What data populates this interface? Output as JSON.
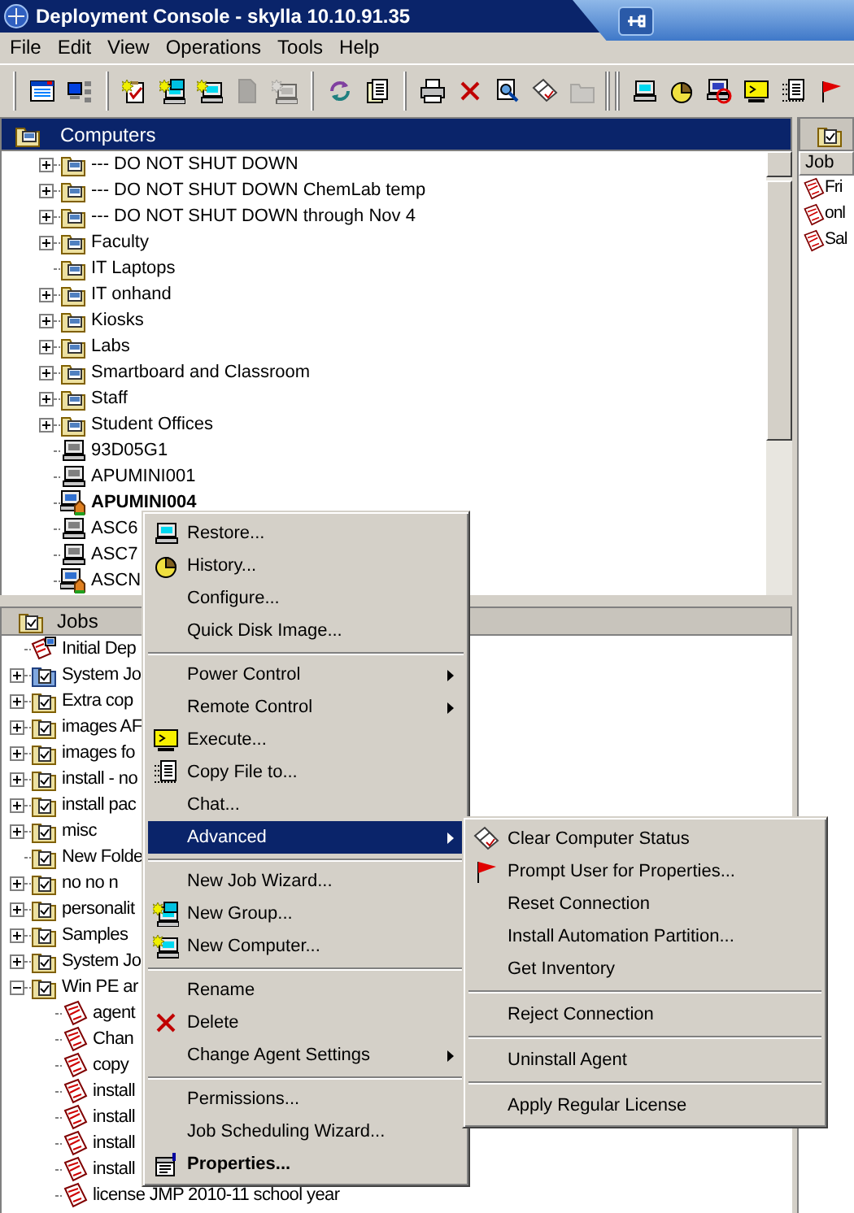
{
  "window": {
    "title": "Deployment Console - skylla 10.10.91.35"
  },
  "menu_bar": [
    "File",
    "Edit",
    "View",
    "Operations",
    "Tools",
    "Help"
  ],
  "toolbar": [
    [
      {
        "kind": "window",
        "disabled": false
      },
      {
        "kind": "network",
        "disabled": false
      }
    ],
    [
      {
        "kind": "clipboard-check",
        "disabled": false
      },
      {
        "kind": "computers-new",
        "disabled": false
      },
      {
        "kind": "computer-new",
        "disabled": false
      },
      {
        "kind": "document",
        "disabled": true
      },
      {
        "kind": "sparkle",
        "disabled": true
      }
    ],
    [
      {
        "kind": "refresh",
        "disabled": false
      },
      {
        "kind": "documents",
        "disabled": false
      }
    ],
    [
      {
        "kind": "printer",
        "disabled": false
      },
      {
        "kind": "delete",
        "disabled": false
      },
      {
        "kind": "magnifier",
        "disabled": false
      },
      {
        "kind": "papers",
        "disabled": false
      },
      {
        "kind": "folder",
        "disabled": true
      }
    ],
    [
      {
        "kind": "computer",
        "disabled": false
      },
      {
        "kind": "pie",
        "disabled": false
      },
      {
        "kind": "computer-red",
        "disabled": false
      },
      {
        "kind": "console",
        "disabled": false
      },
      {
        "kind": "doc-list",
        "disabled": false
      },
      {
        "kind": "flag",
        "disabled": false
      }
    ]
  ],
  "computers_pane": {
    "title": "Computers",
    "tree": [
      {
        "label": "--- DO NOT SHUT DOWN",
        "kind": "group",
        "has_children": true,
        "bold": false
      },
      {
        "label": "--- DO NOT SHUT DOWN ChemLab temp",
        "kind": "group",
        "has_children": true,
        "bold": false
      },
      {
        "label": "--- DO NOT SHUT DOWN through Nov 4",
        "kind": "group",
        "has_children": true,
        "bold": false
      },
      {
        "label": "Faculty",
        "kind": "group",
        "has_children": true,
        "bold": false
      },
      {
        "label": "IT Laptops",
        "kind": "group",
        "has_children": false,
        "bold": false
      },
      {
        "label": "IT onhand",
        "kind": "group",
        "has_children": true,
        "bold": false
      },
      {
        "label": "Kiosks",
        "kind": "group",
        "has_children": true,
        "bold": false
      },
      {
        "label": "Labs",
        "kind": "group",
        "has_children": true,
        "bold": false
      },
      {
        "label": "Smartboard and Classroom",
        "kind": "group",
        "has_children": true,
        "bold": false
      },
      {
        "label": "Staff",
        "kind": "group",
        "has_children": true,
        "bold": false
      },
      {
        "label": "Student Offices",
        "kind": "group",
        "has_children": true,
        "bold": false
      },
      {
        "label": "93D05G1",
        "kind": "computer-offline",
        "bold": false
      },
      {
        "label": "APUMINI001",
        "kind": "computer-offline",
        "bold": false
      },
      {
        "label": "APUMINI004",
        "kind": "computer-agent",
        "bold": true
      },
      {
        "label": "ASC6",
        "kind": "computer-offline",
        "bold": false
      },
      {
        "label": "ASC7",
        "kind": "computer-offline",
        "bold": false
      },
      {
        "label": "ASCN",
        "kind": "computer-agent",
        "bold": false
      }
    ]
  },
  "jobs_pane": {
    "title": "Jobs",
    "tree": [
      {
        "label": "Initial Dep",
        "kind": "job-special",
        "has_children": false
      },
      {
        "label": "System Jo",
        "kind": "system-folder",
        "has_children": true,
        "expanded": false
      },
      {
        "label": "Extra cop",
        "kind": "job-folder",
        "has_children": true,
        "expanded": false
      },
      {
        "label": "images AF",
        "kind": "job-folder",
        "has_children": true,
        "expanded": false
      },
      {
        "label": "images fo",
        "kind": "job-folder",
        "has_children": true,
        "expanded": false
      },
      {
        "label": "install - no",
        "kind": "job-folder",
        "has_children": true,
        "expanded": false
      },
      {
        "label": "install pac",
        "kind": "job-folder",
        "has_children": true,
        "expanded": false
      },
      {
        "label": "misc",
        "kind": "job-folder",
        "has_children": true,
        "expanded": false
      },
      {
        "label": "New Folde",
        "kind": "job-folder",
        "has_children": false
      },
      {
        "label": "no  no  n",
        "kind": "job-folder",
        "has_children": true,
        "expanded": false
      },
      {
        "label": "personalit",
        "kind": "job-folder",
        "has_children": true,
        "expanded": false
      },
      {
        "label": "Samples",
        "kind": "job-folder",
        "has_children": true,
        "expanded": false
      },
      {
        "label": "System Jo",
        "kind": "job-folder",
        "has_children": true,
        "expanded": false
      },
      {
        "label": "Win PE ar",
        "kind": "job-folder",
        "has_children": true,
        "expanded": true,
        "children": [
          {
            "label": "agent",
            "kind": "job"
          },
          {
            "label": "Chan",
            "kind": "job"
          },
          {
            "label": "copy",
            "kind": "job"
          },
          {
            "label": "install",
            "kind": "job"
          },
          {
            "label": "install",
            "kind": "job"
          },
          {
            "label": "install",
            "kind": "job"
          },
          {
            "label": "install",
            "kind": "job"
          },
          {
            "label": "license JMP 2010-11 school year",
            "kind": "job"
          }
        ]
      }
    ]
  },
  "job_list": {
    "columns": [
      "Job"
    ],
    "rows": [
      "Fri",
      "onl",
      "Sal"
    ]
  },
  "context_menu": {
    "items": [
      {
        "kind": "item",
        "label": "Restore...",
        "has_submenu": false,
        "selected": false,
        "bold": false
      },
      {
        "kind": "item",
        "label": "History...",
        "has_submenu": false,
        "selected": false,
        "bold": false
      },
      {
        "kind": "item",
        "label": "Configure...",
        "has_submenu": false,
        "selected": false,
        "bold": false
      },
      {
        "kind": "item",
        "label": "Quick Disk Image...",
        "has_submenu": false,
        "selected": false,
        "bold": false
      },
      {
        "kind": "separator"
      },
      {
        "kind": "item",
        "label": "Power Control",
        "has_submenu": true,
        "selected": false,
        "bold": false
      },
      {
        "kind": "item",
        "label": "Remote Control",
        "has_submenu": true,
        "selected": false,
        "bold": false
      },
      {
        "kind": "item",
        "label": "Execute...",
        "has_submenu": false,
        "selected": false,
        "bold": false
      },
      {
        "kind": "item",
        "label": "Copy File to...",
        "has_submenu": false,
        "selected": false,
        "bold": false
      },
      {
        "kind": "item",
        "label": "Chat...",
        "has_submenu": false,
        "selected": false,
        "bold": false
      },
      {
        "kind": "item",
        "label": "Advanced",
        "has_submenu": true,
        "selected": true,
        "bold": false
      },
      {
        "kind": "separator"
      },
      {
        "kind": "item",
        "label": "New Job Wizard...",
        "has_submenu": false,
        "selected": false,
        "bold": false
      },
      {
        "kind": "item",
        "label": "New Group...",
        "has_submenu": false,
        "selected": false,
        "bold": false
      },
      {
        "kind": "item",
        "label": "New Computer...",
        "has_submenu": false,
        "selected": false,
        "bold": false
      },
      {
        "kind": "separator"
      },
      {
        "kind": "item",
        "label": "Rename",
        "has_submenu": false,
        "selected": false,
        "bold": false
      },
      {
        "kind": "item",
        "label": "Delete",
        "has_submenu": false,
        "selected": false,
        "bold": false
      },
      {
        "kind": "item",
        "label": "Change Agent Settings",
        "has_submenu": true,
        "selected": false,
        "bold": false
      },
      {
        "kind": "separator"
      },
      {
        "kind": "item",
        "label": "Permissions...",
        "has_submenu": false,
        "selected": false,
        "bold": false
      },
      {
        "kind": "item",
        "label": "Job Scheduling Wizard...",
        "has_submenu": false,
        "selected": false,
        "bold": false
      },
      {
        "kind": "item",
        "label": "Properties...",
        "has_submenu": false,
        "selected": false,
        "bold": true
      }
    ]
  },
  "submenu": {
    "items": [
      {
        "kind": "item",
        "label": "Clear Computer Status",
        "selected": false
      },
      {
        "kind": "item",
        "label": "Prompt User for Properties...",
        "selected": false
      },
      {
        "kind": "item",
        "label": "Reset Connection",
        "selected": false
      },
      {
        "kind": "item",
        "label": "Install Automation Partition...",
        "selected": false
      },
      {
        "kind": "item",
        "label": "Get Inventory",
        "selected": false
      },
      {
        "kind": "separator"
      },
      {
        "kind": "item",
        "label": "Reject Connection",
        "selected": false
      },
      {
        "kind": "separator"
      },
      {
        "kind": "item",
        "label": "Uninstall Agent",
        "selected": false
      },
      {
        "kind": "separator"
      },
      {
        "kind": "item",
        "label": "Apply Regular License",
        "selected": false
      }
    ]
  }
}
